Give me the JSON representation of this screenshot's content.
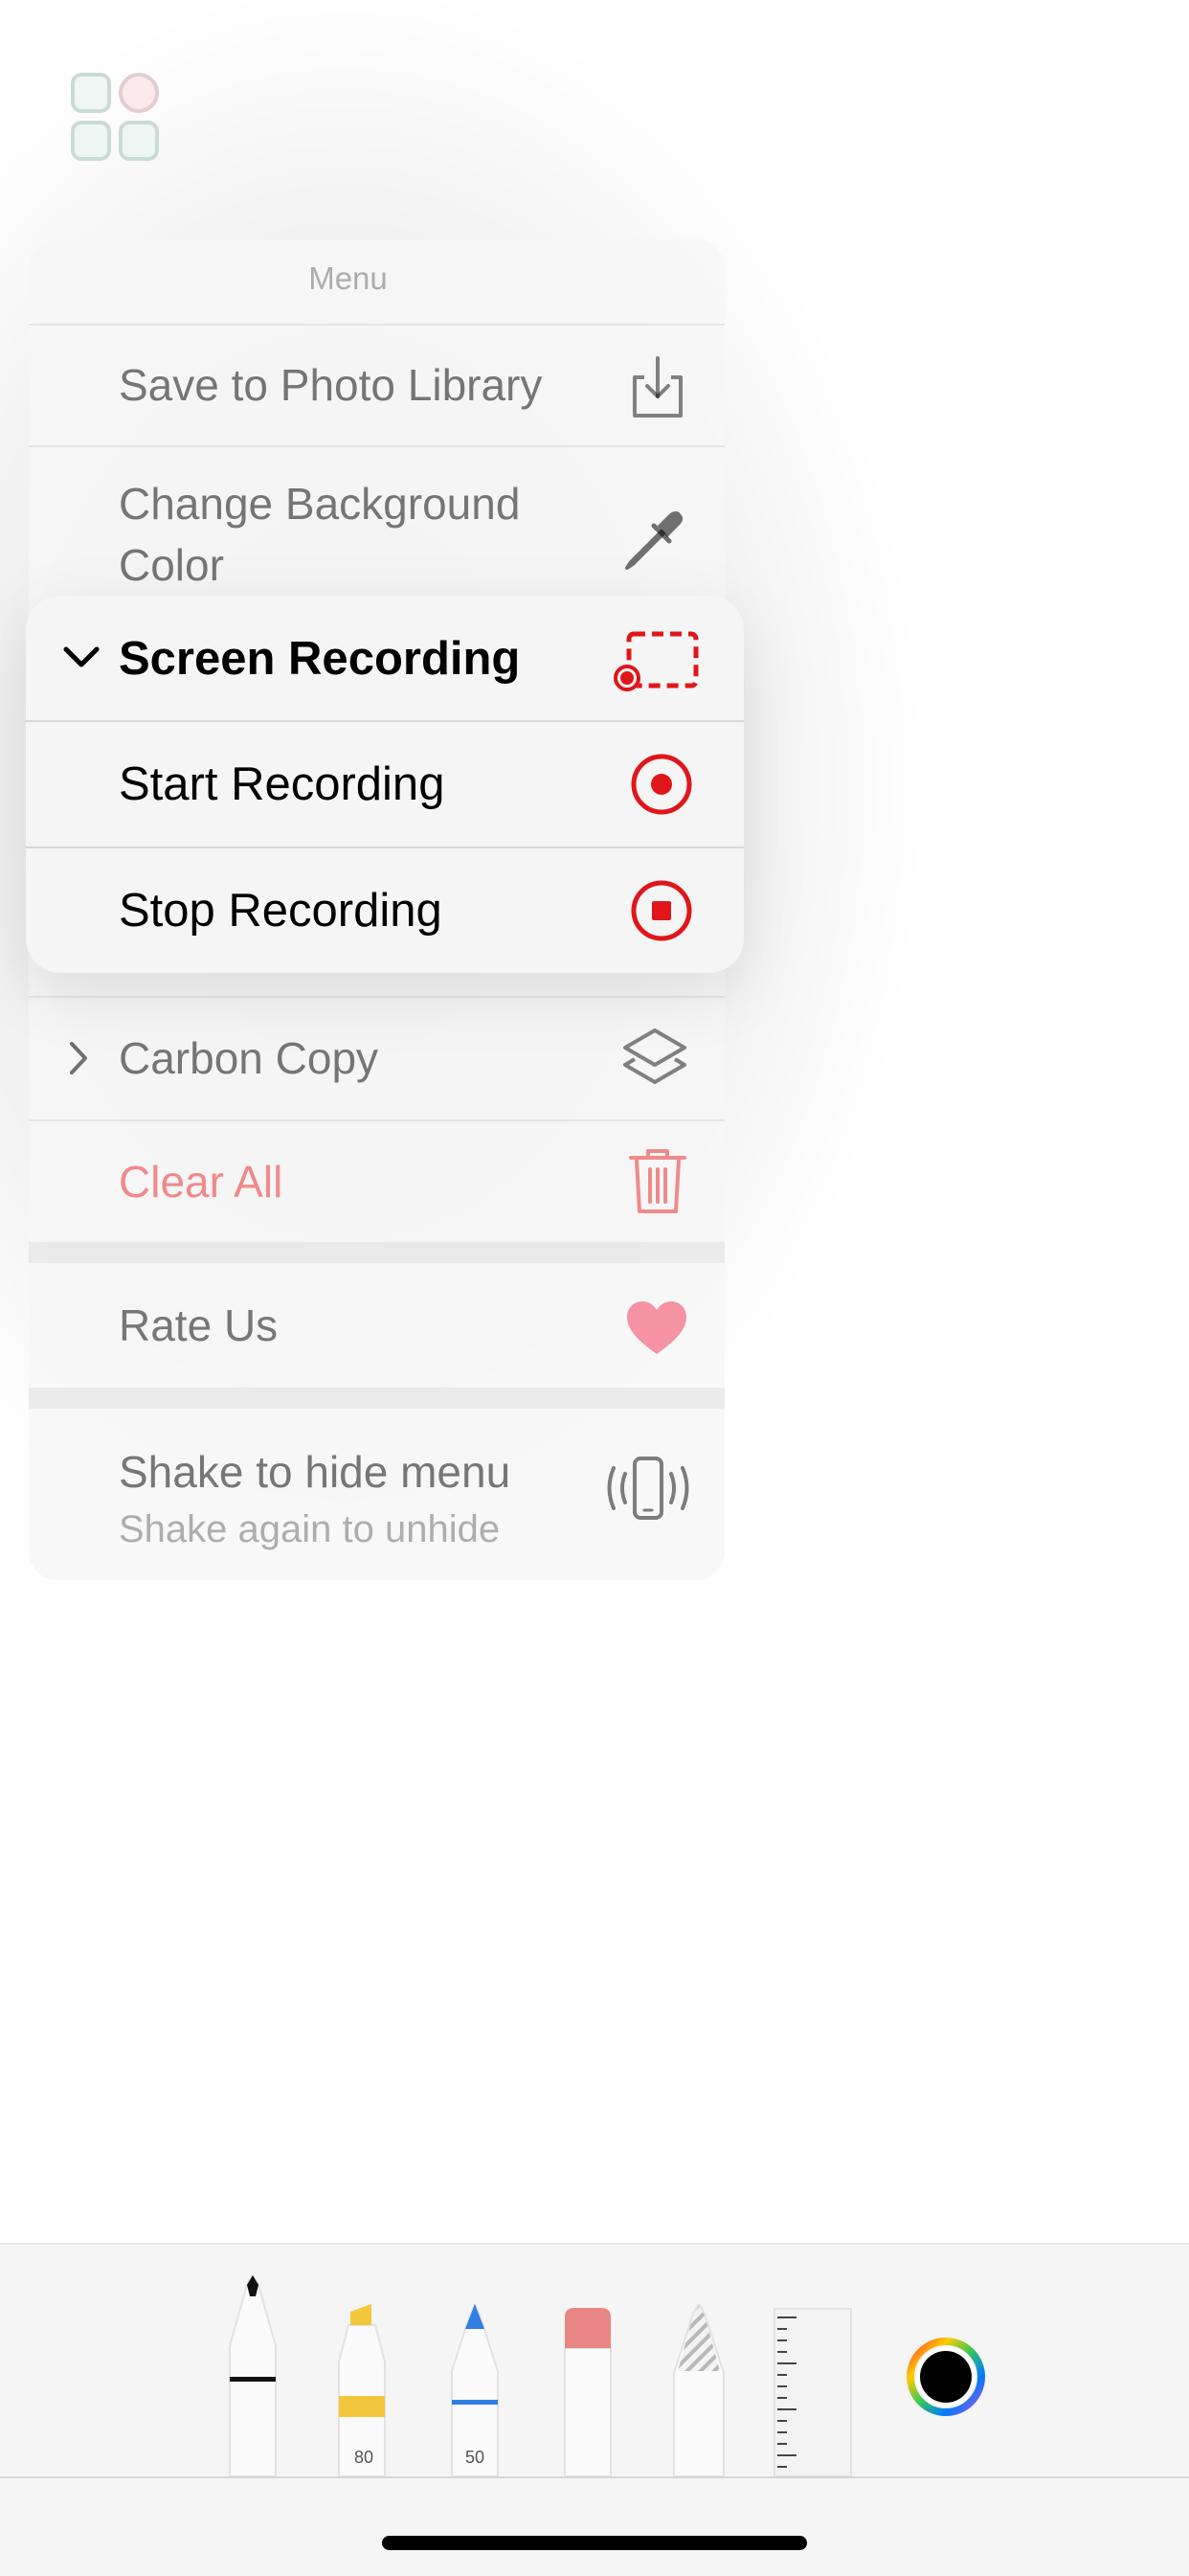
{
  "menu": {
    "title": "Menu",
    "save_label": "Save to Photo Library",
    "background_label_line1": "Change Background",
    "background_label_line2": "Color",
    "carbon_copy_label": "Carbon Copy",
    "clear_all_label": "Clear All",
    "rate_label": "Rate Us",
    "shake_label": "Shake to hide menu",
    "shake_sublabel": "Shake again to unhide"
  },
  "submenu": {
    "title": "Screen Recording",
    "start_label": "Start Recording",
    "stop_label": "Stop Recording"
  },
  "toolbar": {
    "tools": [
      {
        "name": "pen",
        "icon": "pen-icon"
      },
      {
        "name": "marker",
        "icon": "marker-icon",
        "size_label": "80"
      },
      {
        "name": "pencil",
        "icon": "pencil-icon",
        "size_label": "50"
      },
      {
        "name": "eraser",
        "icon": "eraser-icon"
      },
      {
        "name": "lasso",
        "icon": "lasso-icon"
      },
      {
        "name": "ruler",
        "icon": "ruler-icon"
      }
    ],
    "selected_color": "#000000"
  },
  "colors": {
    "record_red": "#e0161b",
    "clear_red": "#f08a8a",
    "heart_pink": "#f593a4"
  }
}
